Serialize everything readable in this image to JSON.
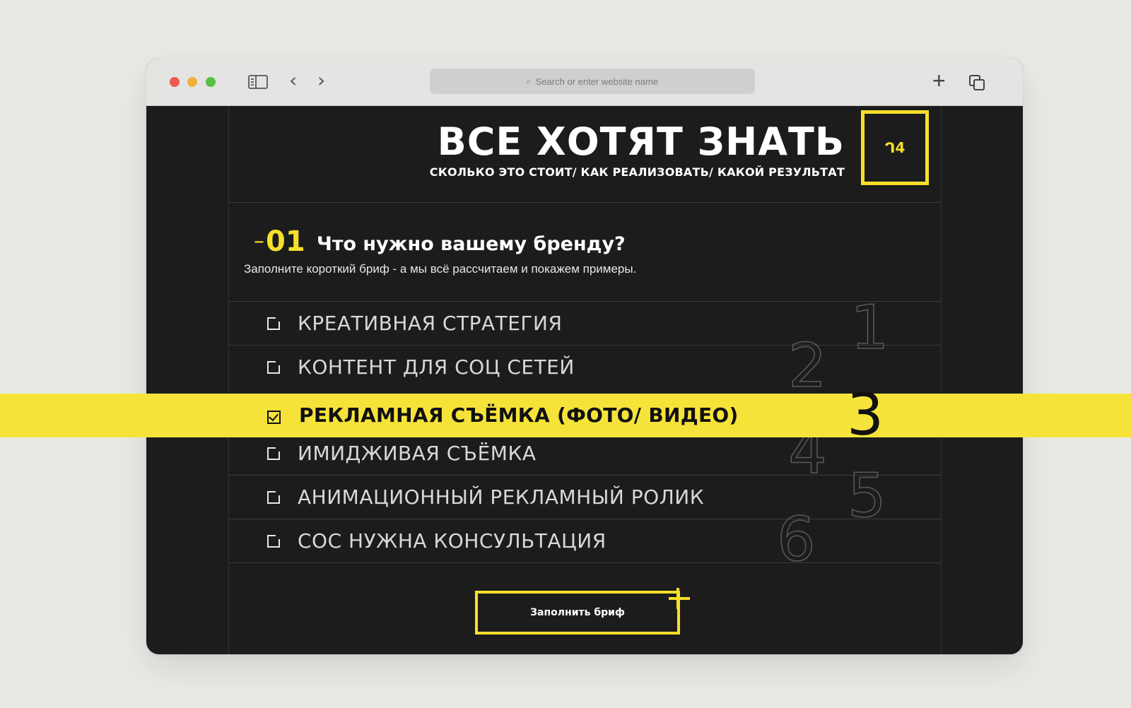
{
  "browser": {
    "address_placeholder": "Search or enter website name"
  },
  "hero": {
    "title": "ВСЕ ХОТЯТ ЗНАТЬ",
    "subtitle": "СКОЛЬКО ЭТО СТОИТ/ КАК РЕАЛИЗОВАТЬ/ КАКОЙ РЕЗУЛЬТАТ",
    "badge": "ᒉ4"
  },
  "question": {
    "number": "01",
    "title": "Что нужно вашему бренду?",
    "description": "Заполните короткий бриф - а мы всё рассчитаем и покажем примеры."
  },
  "options": [
    {
      "label": "КРЕАТИВНАЯ СТРАТЕГИЯ",
      "number": "1",
      "checked": false
    },
    {
      "label": "КОНТЕНТ ДЛЯ СОЦ СЕТЕЙ",
      "number": "2",
      "checked": false
    },
    {
      "label": "РЕКЛАМНАЯ СЪЁМКА (ФОТО/ ВИДЕО)",
      "number": "3",
      "checked": true
    },
    {
      "label": "ИМИДЖИВАЯ СЪЁМКА",
      "number": "4",
      "checked": false
    },
    {
      "label": "АНИМАЦИОННЫЙ РЕКЛАМНЫЙ РОЛИК",
      "number": "5",
      "checked": false
    },
    {
      "label": "СОС НУЖНА КОНСУЛЬТАЦИЯ",
      "number": "6",
      "checked": false
    }
  ],
  "cta": {
    "label": "Заполнить бриф"
  },
  "colors": {
    "accent": "#f7df2a",
    "page_bg": "#1c1c1c"
  }
}
